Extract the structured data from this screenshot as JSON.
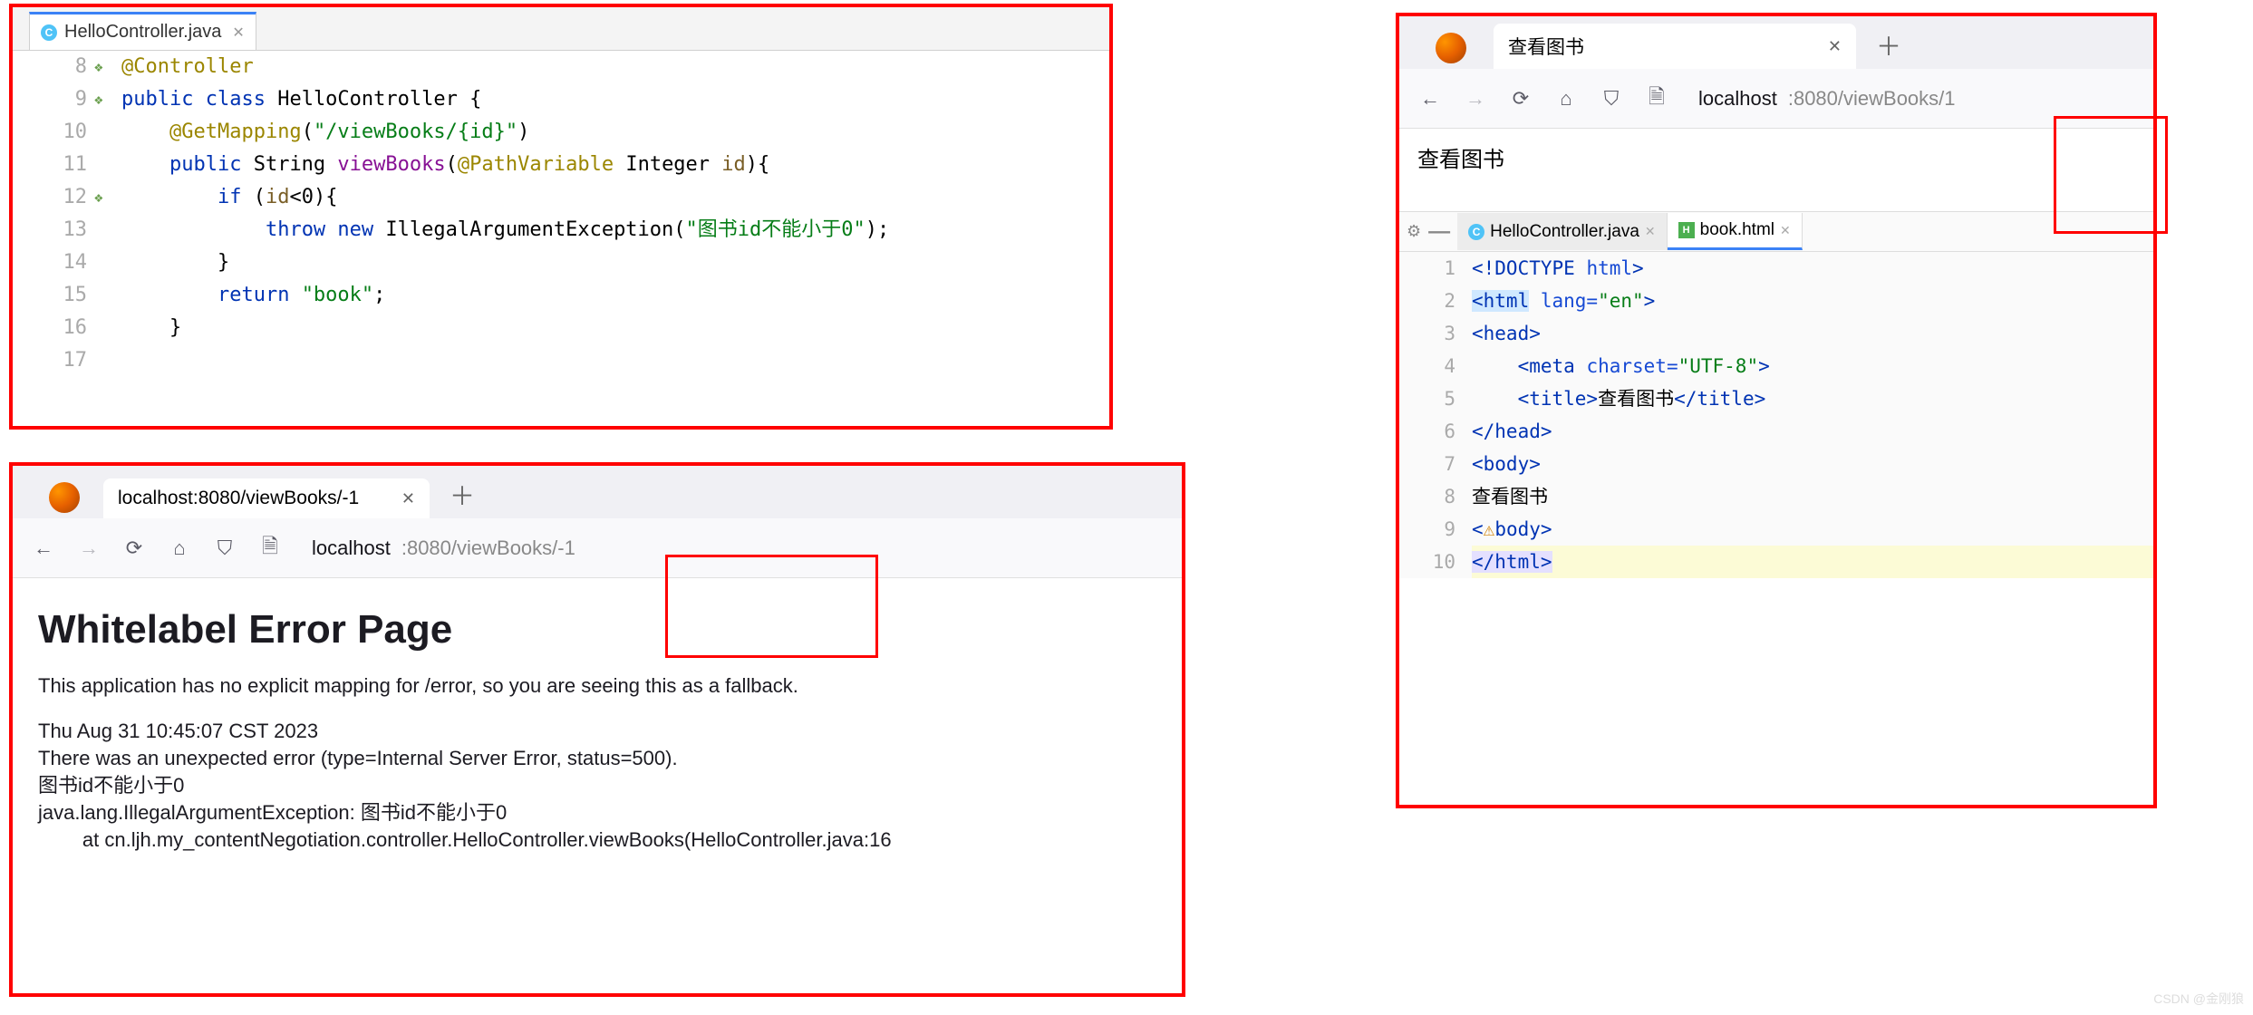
{
  "panel1": {
    "tab_label": "HelloController.java",
    "gutter_start": 8,
    "lines": [
      {
        "n": 8,
        "icon": "leaf",
        "tokens": [
          [
            "ann",
            "@Controller"
          ]
        ]
      },
      {
        "n": 9,
        "icon": "leaf",
        "tokens": [
          [
            "kw",
            "public "
          ],
          [
            "kw",
            "class "
          ],
          [
            "type",
            "HelloController "
          ],
          [
            "plain",
            "{"
          ]
        ]
      },
      {
        "n": 10,
        "tokens": [
          [
            "plain",
            ""
          ]
        ]
      },
      {
        "n": 11,
        "tokens": [
          [
            "plain",
            "    "
          ],
          [
            "ann",
            "@GetMapping"
          ],
          [
            "plain",
            "("
          ],
          [
            "str",
            "\"/viewBooks/{id}\""
          ],
          [
            "plain",
            ")"
          ]
        ]
      },
      {
        "n": 12,
        "icon": "leaf",
        "tokens": [
          [
            "plain",
            "    "
          ],
          [
            "kw",
            "public "
          ],
          [
            "type",
            "String "
          ],
          [
            "ident",
            "viewBooks"
          ],
          [
            "plain",
            "("
          ],
          [
            "ann",
            "@PathVariable "
          ],
          [
            "type",
            "Integer "
          ],
          [
            "param",
            "id"
          ],
          [
            "plain",
            "){"
          ]
        ]
      },
      {
        "n": 13,
        "tokens": [
          [
            "plain",
            "        "
          ],
          [
            "kw",
            "if "
          ],
          [
            "plain",
            "("
          ],
          [
            "param",
            "id"
          ],
          [
            "plain",
            "<"
          ],
          [
            "plain",
            "0"
          ],
          [
            "plain",
            "){"
          ]
        ]
      },
      {
        "n": 14,
        "tokens": [
          [
            "plain",
            "            "
          ],
          [
            "kw",
            "throw new "
          ],
          [
            "type",
            "IllegalArgumentException"
          ],
          [
            "plain",
            "("
          ],
          [
            "str",
            "\"图书id不能小于0\""
          ],
          [
            "plain",
            ");"
          ]
        ]
      },
      {
        "n": 15,
        "tokens": [
          [
            "plain",
            "        }"
          ]
        ]
      },
      {
        "n": 16,
        "tokens": [
          [
            "plain",
            "        "
          ],
          [
            "kw",
            "return "
          ],
          [
            "str",
            "\"book\""
          ],
          [
            "plain",
            ";"
          ]
        ]
      },
      {
        "n": 17,
        "tokens": [
          [
            "plain",
            "    }"
          ]
        ]
      }
    ]
  },
  "panel2": {
    "tab_title": "localhost:8080/viewBooks/-1",
    "url_dark": "localhost",
    "url_light": ":8080/viewBooks/-1",
    "h1": "Whitelabel Error Page",
    "p1": "This application has no explicit mapping for /error, so you are seeing this as a fallback.",
    "line1": "Thu Aug 31 10:45:07 CST 2023",
    "line2": "There was an unexpected error (type=Internal Server Error, status=500).",
    "line3": "图书id不能小于0",
    "line4": "java.lang.IllegalArgumentException: 图书id不能小于0",
    "line5": "        at cn.ljh.my_contentNegotiation.controller.HelloController.viewBooks(HelloController.java:16"
  },
  "panel3": {
    "tab_title": "查看图书",
    "url_dark": "localhost",
    "url_light": ":8080/viewBooks/1",
    "page_text": "查看图书",
    "subtab1": "HelloController.java",
    "subtab2": "book.html",
    "html_lines": [
      {
        "n": 1,
        "html": "<span class='tag'>&lt;!DOCTYPE </span><span class='attr'>html</span><span class='tag'>&gt;</span>"
      },
      {
        "n": 2,
        "html": "<span class='hl-sel'><span class='tag'>&lt;html</span></span><span class='attr'> lang=</span><span class='aval'>\"en\"</span><span class='tag'>&gt;</span>"
      },
      {
        "n": 3,
        "html": "<span class='tag'>&lt;head&gt;</span>"
      },
      {
        "n": 4,
        "html": "    <span class='tag'>&lt;meta </span><span class='attr'>charset=</span><span class='aval'>\"UTF-8\"</span><span class='tag'>&gt;</span>"
      },
      {
        "n": 5,
        "html": "    <span class='tag'>&lt;title&gt;</span><span class='txt'>查看图书</span><span class='tag'>&lt;/title&gt;</span>"
      },
      {
        "n": 6,
        "html": "<span class='tag'>&lt;/head&gt;</span>"
      },
      {
        "n": 7,
        "html": "<span class='tag'>&lt;body&gt;</span>"
      },
      {
        "n": 8,
        "html": "<span class='txt'>查看图书</span>"
      },
      {
        "n": 9,
        "html": "<span class='tag'>&lt;<span style='color:#d08000'>⚠</span>body&gt;</span>"
      },
      {
        "n": 10,
        "cur": true,
        "html": "<span class='hl-end'><span class='tag'>&lt;/html&gt;</span></span>"
      }
    ]
  },
  "watermark": "CSDN @金刚狼"
}
